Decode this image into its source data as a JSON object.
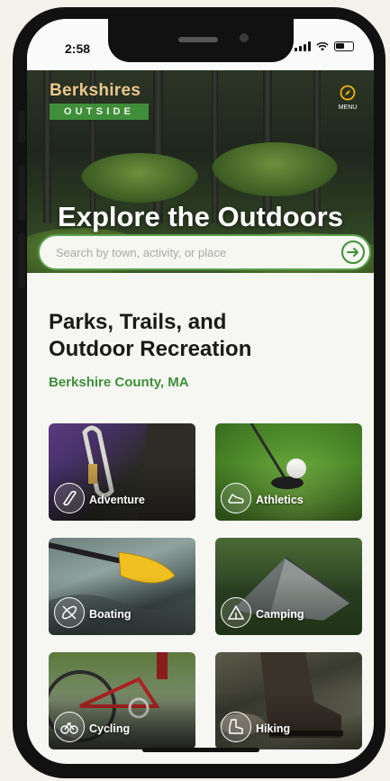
{
  "status_bar": {
    "time": "2:58"
  },
  "header": {
    "logo_line1": "Berkshires",
    "logo_line2": "OUTSIDE",
    "menu_label": "MENU",
    "hero_title": "Explore the Outdoors"
  },
  "search": {
    "placeholder": "Search by town, activity, or place"
  },
  "main": {
    "heading_line1": "Parks, Trails, and",
    "heading_line2": "Outdoor Recreation",
    "subheading": "Berkshire County, MA"
  },
  "categories": [
    {
      "label": "Adventure",
      "icon": "carabiner-icon"
    },
    {
      "label": "Athletics",
      "icon": "sneaker-icon"
    },
    {
      "label": "Boating",
      "icon": "kayak-icon"
    },
    {
      "label": "Camping",
      "icon": "tent-icon"
    },
    {
      "label": "Cycling",
      "icon": "bicycle-icon"
    },
    {
      "label": "Hiking",
      "icon": "boot-icon"
    }
  ],
  "colors": {
    "brand_green": "#3f8f3a",
    "logo_gold": "#e9c78d"
  }
}
